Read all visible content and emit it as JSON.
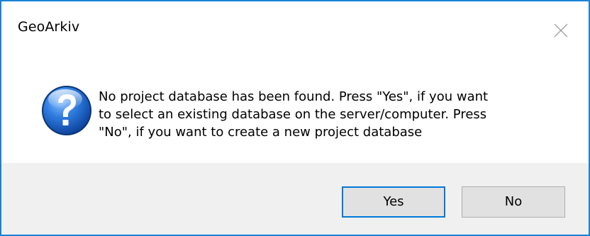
{
  "window": {
    "title": "GeoArkiv"
  },
  "content": {
    "icon": "question-icon",
    "message": "No project database has been found. Press \"Yes\", if you want\nto select an existing database on the server/computer. Press\n\"No\", if you want to create a new project database"
  },
  "buttons": {
    "yes_label": "Yes",
    "no_label": "No"
  },
  "colors": {
    "window_border": "#1883d7",
    "footer_background": "#f0f0f0",
    "button_background": "#e1e1e1",
    "default_button_border": "#0078d7",
    "icon_blue": "#1e64c4"
  }
}
